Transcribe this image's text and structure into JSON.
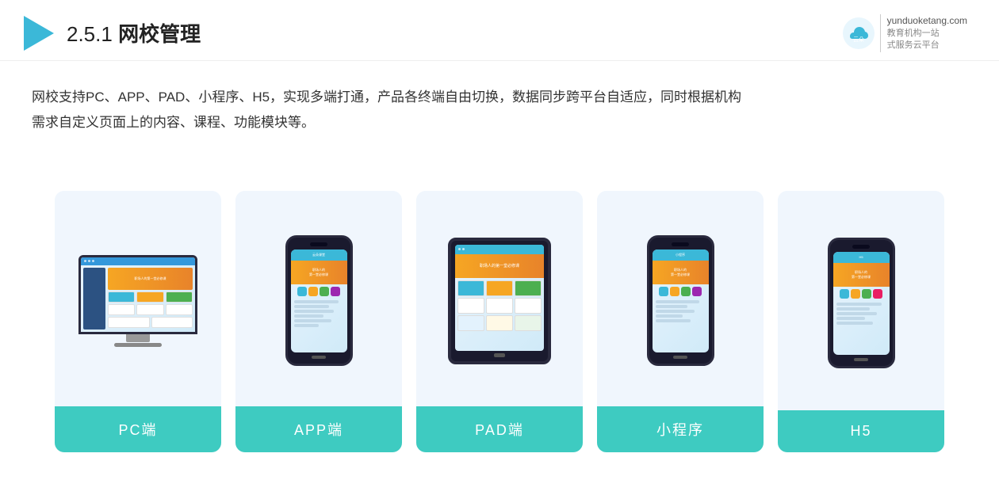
{
  "header": {
    "section": "2.5.1",
    "title_normal": "2.5.1 ",
    "title_bold": "网校管理",
    "brand_url": "yunduoketang.com",
    "brand_tagline1": "教育机构一站",
    "brand_tagline2": "式服务云平台"
  },
  "description": {
    "line1": "网校支持PC、APP、PAD、小程序、H5，实现多端打通，产品各终端自由切换，数据同步跨平台自适应，同时根据机构",
    "line2": "需求自定义页面上的内容、课程、功能模块等。"
  },
  "cards": [
    {
      "id": "pc",
      "label": "PC端"
    },
    {
      "id": "app",
      "label": "APP端"
    },
    {
      "id": "pad",
      "label": "PAD端"
    },
    {
      "id": "miniapp",
      "label": "小程序"
    },
    {
      "id": "h5",
      "label": "H5"
    }
  ]
}
